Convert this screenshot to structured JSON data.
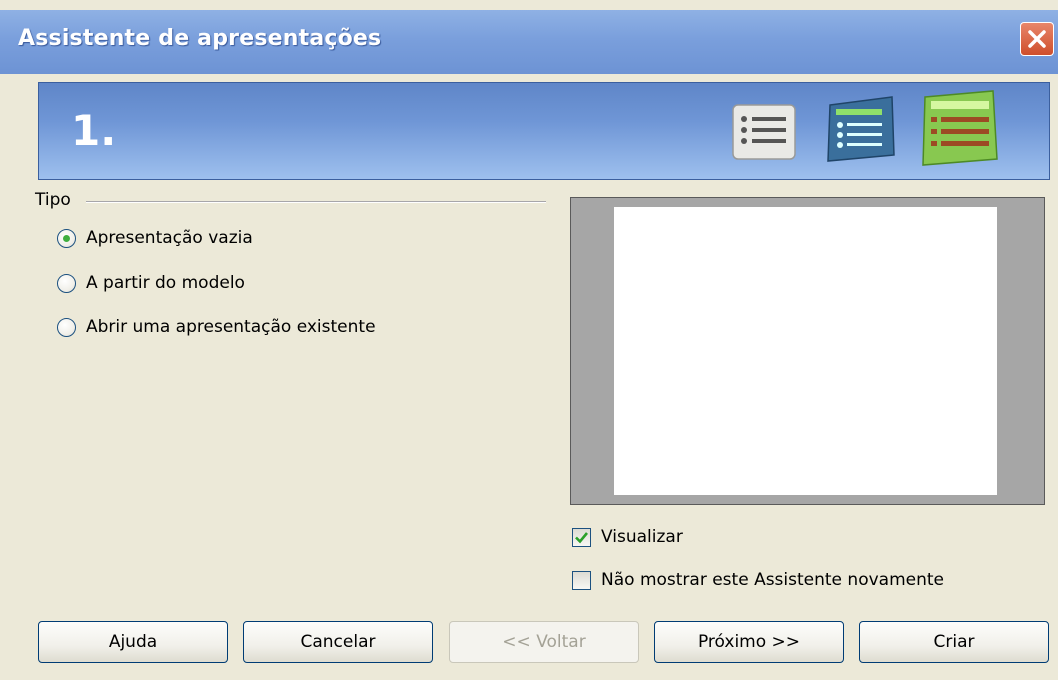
{
  "window": {
    "title": "Assistente de apresentações",
    "close_icon": "close-icon"
  },
  "banner": {
    "step": "1.",
    "icons": [
      "list-page-icon",
      "list-card-icon",
      "list-active-icon"
    ]
  },
  "tipo": {
    "label": "Tipo",
    "options": [
      {
        "label": "Apresentação vazia",
        "selected": true
      },
      {
        "label": "A partir do modelo",
        "selected": false
      },
      {
        "label": "Abrir uma apresentação existente",
        "selected": false
      }
    ]
  },
  "options": {
    "preview_label": "Visualizar",
    "preview_checked": true,
    "dont_show_label": "Não mostrar este Assistente novamente",
    "dont_show_checked": false
  },
  "buttons": {
    "help": "Ajuda",
    "cancel": "Cancelar",
    "back": "<< Voltar",
    "next": "Próximo >>",
    "create": "Criar"
  },
  "colors": {
    "titlebar": "#7a9fdc",
    "banner": "#6f96d6",
    "accent_green": "#3fae3f",
    "dialog_bg": "#ece9d8"
  }
}
